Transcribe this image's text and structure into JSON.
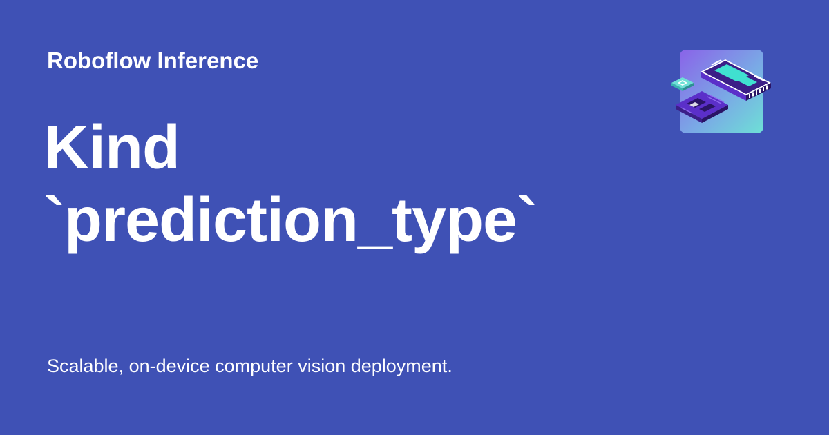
{
  "header": {
    "site_name": "Roboflow Inference",
    "logo_icon": "hardware-chip-logo-icon"
  },
  "main": {
    "title_line_1": "Kind",
    "title_line_2": "`prediction_type`",
    "description": "Scalable, on-device computer vision deployment."
  },
  "colors": {
    "background": "#3f51b5",
    "text": "#ffffff",
    "logo_tile_start": "#8a63e8",
    "logo_tile_end": "#6ee0d6",
    "logo_purple": "#3b1e87",
    "logo_teal": "#40e0d0"
  }
}
